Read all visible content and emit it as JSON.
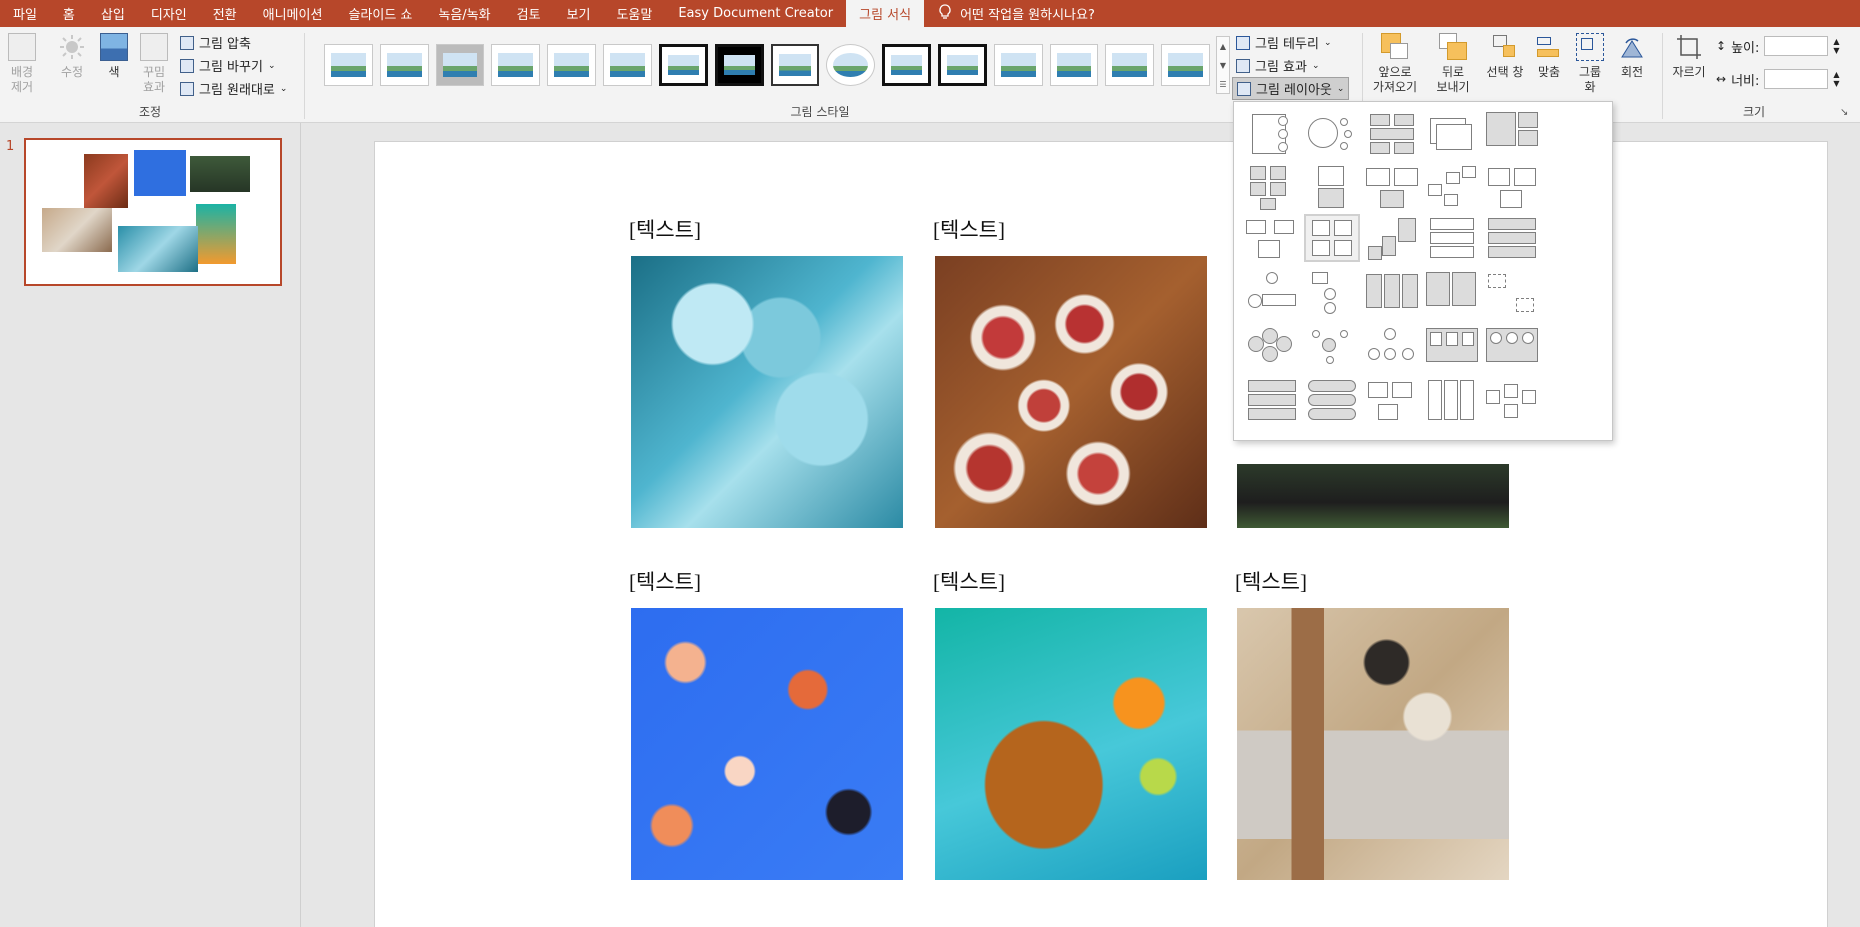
{
  "tabs": [
    {
      "label": "파일"
    },
    {
      "label": "홈"
    },
    {
      "label": "삽입"
    },
    {
      "label": "디자인"
    },
    {
      "label": "전환"
    },
    {
      "label": "애니메이션"
    },
    {
      "label": "슬라이드 쇼"
    },
    {
      "label": "녹음/녹화"
    },
    {
      "label": "검토"
    },
    {
      "label": "보기"
    },
    {
      "label": "도움말"
    },
    {
      "label": "Easy Document Creator"
    },
    {
      "label": "그림 서식"
    }
  ],
  "tell_me": "어떤 작업을 원하시나요?",
  "ribbon": {
    "adjust": {
      "remove_bg": "배경\n제거",
      "corrections": "수정",
      "color": "색",
      "artistic": "꾸밈\n효과",
      "compress": "그림 압축",
      "change": "그림 바꾸기",
      "reset": "그림 원래대로",
      "group_label": "조정"
    },
    "styles": {
      "group_label": "그림 스타일"
    },
    "picture_format": {
      "border": "그림 테두리",
      "effects": "그림 효과",
      "layout": "그림 레이아웃"
    },
    "arrange": {
      "bring_forward": "앞으로\n가져오기",
      "send_backward": "뒤로\n보내기",
      "selection_pane": "선택 창",
      "align": "맞춤",
      "group": "그룹\n화",
      "rotate": "회전"
    },
    "size": {
      "crop": "자르기",
      "height_label": "높이:",
      "width_label": "너비:",
      "height_value": "",
      "width_value": "",
      "group_label": "크기"
    }
  },
  "slide_panel": {
    "slide_number": "1"
  },
  "slide": {
    "labels": [
      "[텍스트]",
      "[텍스트]",
      "[텍스트]",
      "[텍스트]",
      "[텍스트]"
    ]
  },
  "colors": {
    "accent": "#b7472a",
    "ribbon_bg": "#f3f3f3",
    "canvas_bg": "#e6e6e6"
  }
}
